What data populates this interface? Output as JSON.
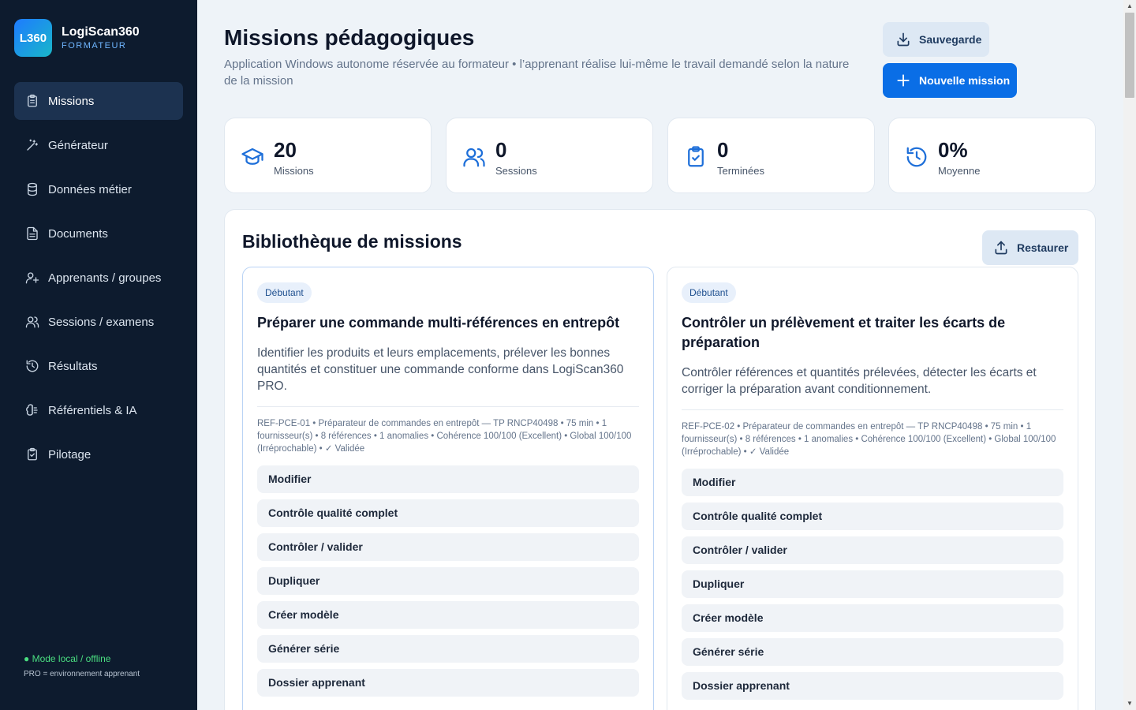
{
  "brand": {
    "logo_text": "L360",
    "name": "LogiScan360",
    "subtitle": "FORMATEUR"
  },
  "sidebar": {
    "items": [
      {
        "label": "Missions",
        "icon": "clipboard-icon",
        "active": true
      },
      {
        "label": "Générateur",
        "icon": "magic-wand-icon"
      },
      {
        "label": "Données métier",
        "icon": "database-icon"
      },
      {
        "label": "Documents",
        "icon": "document-icon"
      },
      {
        "label": "Apprenants / groupes",
        "icon": "user-plus-icon"
      },
      {
        "label": "Sessions / examens",
        "icon": "users-icon"
      },
      {
        "label": "Résultats",
        "icon": "history-icon"
      },
      {
        "label": "Référentiels & IA",
        "icon": "brain-icon"
      },
      {
        "label": "Pilotage",
        "icon": "clipboard-check-icon"
      }
    ],
    "footer": {
      "mode": "● Mode local / offline",
      "note": "PRO = environnement apprenant"
    }
  },
  "header": {
    "title": "Missions pédagogiques",
    "subtitle": "Application Windows autonome réservée au formateur • l’apprenant réalise lui-même le travail demandé selon la nature de la mission",
    "save_label": "Sauvegarde",
    "new_label": "Nouvelle mission"
  },
  "stats": [
    {
      "value": "20",
      "label": "Missions",
      "icon": "graduation-cap-icon"
    },
    {
      "value": "0",
      "label": "Sessions",
      "icon": "users-icon"
    },
    {
      "value": "0",
      "label": "Terminées",
      "icon": "clipboard-check-icon"
    },
    {
      "value": "0%",
      "label": "Moyenne",
      "icon": "history-icon"
    }
  ],
  "library": {
    "title": "Bibliothèque de missions",
    "restore_label": "Restaurer",
    "cards": [
      {
        "level": "Débutant",
        "title": "Préparer une commande multi-références en entrepôt",
        "description": "Identifier les produits et leurs emplacements, prélever les bonnes quantités et constituer une commande conforme dans LogiScan360 PRO.",
        "meta": "REF-PCE-01 • Préparateur de commandes en entrepôt — TP RNCP40498 • 75 min • 1 fournisseur(s) • 8 références • 1 anomalies • Cohérence 100/100 (Excellent) • Global 100/100 (Irréprochable) • ✓ Validée",
        "actions": [
          "Modifier",
          "Contrôle qualité complet",
          "Contrôler / valider",
          "Dupliquer",
          "Créer modèle",
          "Générer série",
          "Dossier apprenant"
        ]
      },
      {
        "level": "Débutant",
        "title": "Contrôler un prélèvement et traiter les écarts de préparation",
        "description": "Contrôler références et quantités prélevées, détecter les écarts et corriger la préparation avant conditionnement.",
        "meta": "REF-PCE-02 • Préparateur de commandes en entrepôt — TP RNCP40498 • 75 min • 1 fournisseur(s) • 8 références • 1 anomalies • Cohérence 100/100 (Excellent) • Global 100/100 (Irréprochable) • ✓ Validée",
        "actions": [
          "Modifier",
          "Contrôle qualité complet",
          "Contrôler / valider",
          "Dupliquer",
          "Créer modèle",
          "Générer série",
          "Dossier apprenant"
        ]
      }
    ]
  },
  "colors": {
    "sidebar_bg": "#0d1b2e",
    "accent": "#0a6ee6",
    "success": "#4ade80"
  }
}
